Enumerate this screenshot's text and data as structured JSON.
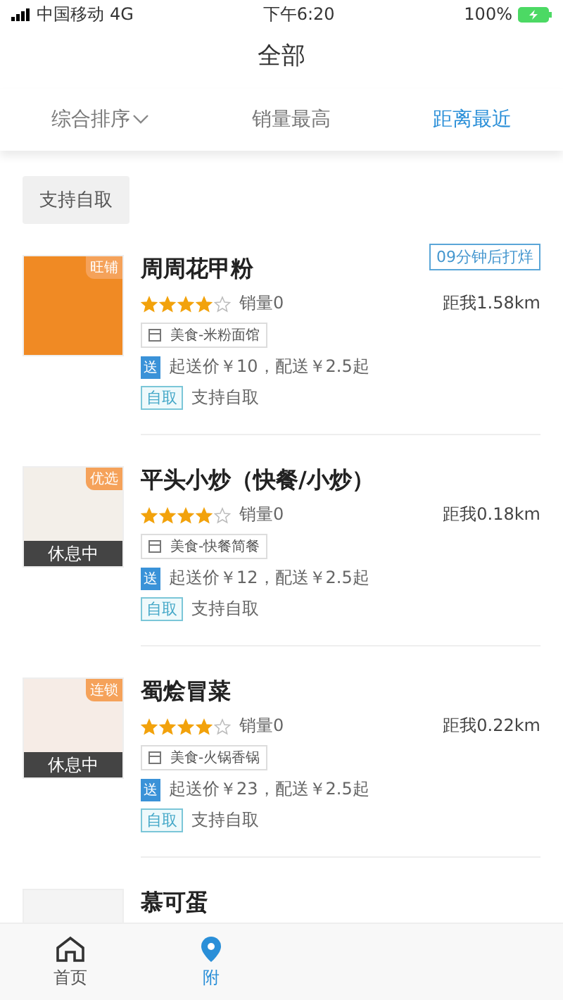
{
  "status_bar": {
    "carrier": "中国移动",
    "network": "4G",
    "time": "下午6:20",
    "battery": "100%"
  },
  "title": "全部",
  "sort_tabs": [
    {
      "label": "综合排序",
      "dropdown": true,
      "selected": false
    },
    {
      "label": "销量最高",
      "dropdown": false,
      "selected": false
    },
    {
      "label": "距离最近",
      "dropdown": false,
      "selected": true
    }
  ],
  "filter_chip": "支持自取",
  "stores": [
    {
      "name": "周周花甲粉",
      "badge": "旺铺",
      "closing_notice": "09分钟后打烊",
      "stars": 4,
      "sales": "销量0",
      "distance": "距我1.58km",
      "category": "美食-米粉面馆",
      "delivery_tag": "送",
      "delivery": "起送价￥10，配送￥2.5起",
      "pickup_tag": "自取",
      "pickup": "支持自取"
    },
    {
      "name": "平头小炒（快餐/小炒）",
      "badge": "优选",
      "resting": true,
      "resting_label": "休息中",
      "stars": 4,
      "sales": "销量0",
      "distance": "距我0.18km",
      "category": "美食-快餐简餐",
      "delivery_tag": "送",
      "delivery": "起送价￥12，配送￥2.5起",
      "pickup_tag": "自取",
      "pickup": "支持自取"
    },
    {
      "name": "蜀烩冒菜",
      "badge": "连锁",
      "resting": true,
      "resting_label": "休息中",
      "stars": 4,
      "sales": "销量0",
      "distance": "距我0.22km",
      "category": "美食-火锅香锅",
      "delivery_tag": "送",
      "delivery": "起送价￥23，配送￥2.5起",
      "pickup_tag": "自取",
      "pickup": "支持自取"
    },
    {
      "name": "慕可蛋"
    }
  ],
  "bottom_tabs": [
    {
      "label": "首页",
      "selected": false
    },
    {
      "label": "附",
      "selected": true
    }
  ]
}
